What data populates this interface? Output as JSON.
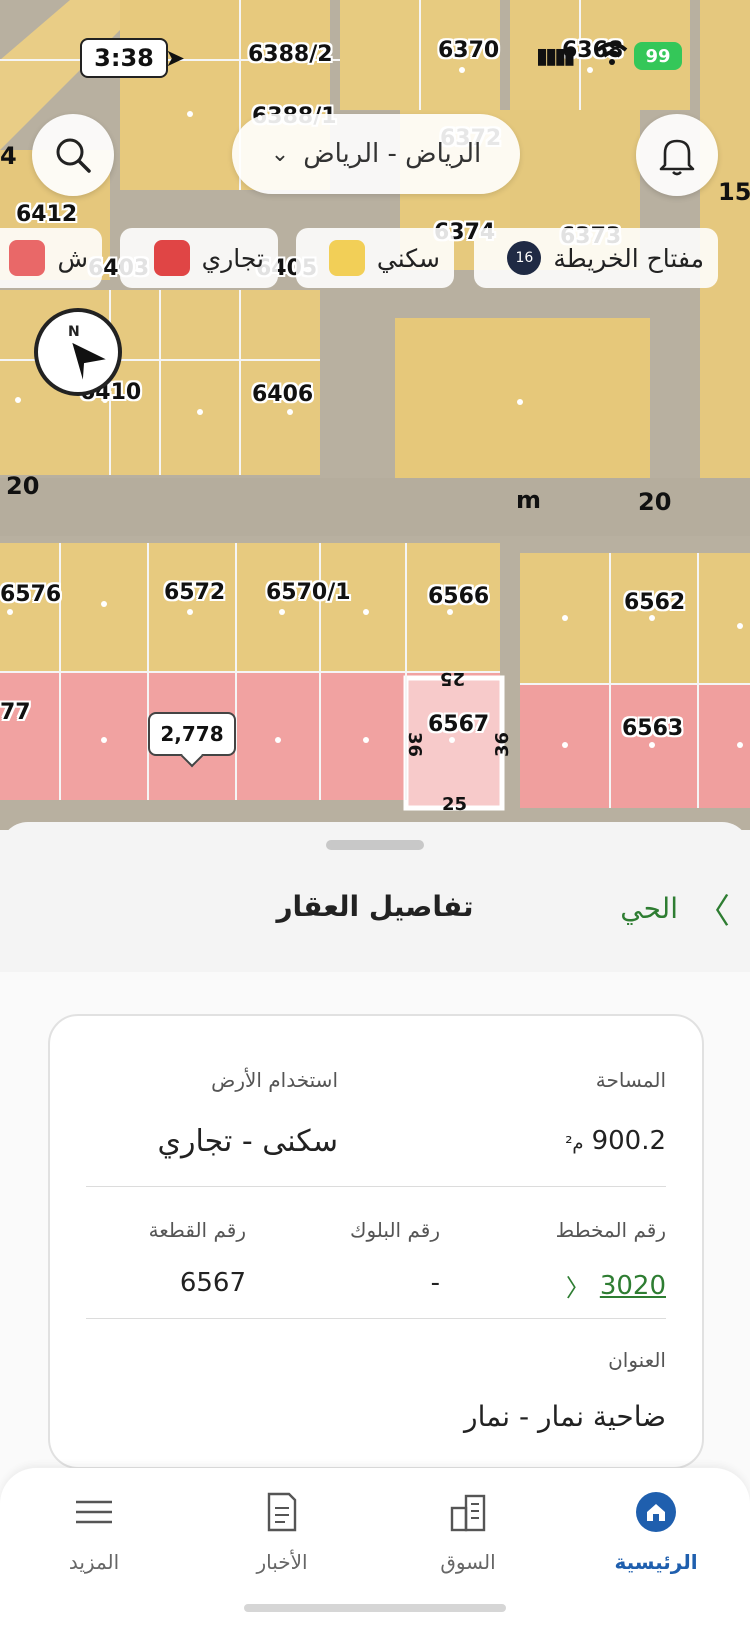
{
  "status_bar": {
    "time": "3:38",
    "battery": "99"
  },
  "header": {
    "city": "الرياض - الرياض",
    "search_icon": "search-icon",
    "bell_icon": "bell-icon"
  },
  "legend": {
    "title": "مفتاح الخريطة",
    "zoom": "16",
    "items": [
      {
        "label": "سكني",
        "color": "#f2cf57"
      },
      {
        "label": "تجاري",
        "color": "#e04545"
      },
      {
        "label": "ش",
        "color": "#e96868"
      }
    ]
  },
  "map": {
    "plots": [
      "6388/2",
      "6370",
      "6368",
      "6388/1",
      "6372",
      "6412",
      "6374",
      "6373",
      "6403",
      "6405",
      "6410",
      "6406",
      "6576",
      "6572",
      "6570/1",
      "6566",
      "6562",
      "6567",
      "6563",
      "77"
    ],
    "street_widths": [
      "20",
      "20",
      "15",
      "4"
    ],
    "dimensions": {
      "top": "25",
      "bottom": "25",
      "left": "36",
      "right": "36"
    },
    "marker": "m",
    "price": "2,778",
    "compass": "N",
    "colors": {
      "residential": "#e8c97a",
      "commercial": "#f2a0a0",
      "selected": "#f7c5c5",
      "road": "#b8b0a0"
    }
  },
  "sheet": {
    "title": "تفاصيل العقار",
    "back_label": "الحي"
  },
  "details": {
    "area_label": "المساحة",
    "area_value": "900.2",
    "area_unit": "م²",
    "land_use_label": "استخدام الأرض",
    "land_use_value": "سكنى - تجاري",
    "plan_label": "رقم المخطط",
    "plan_value": "3020",
    "block_label": "رقم البلوك",
    "block_value": "-",
    "plot_label": "رقم القطعة",
    "plot_value": "6567",
    "address_label": "العنوان",
    "address_value": "ضاحية نمار - نمار"
  },
  "nav": {
    "home": "الرئيسية",
    "market": "السوق",
    "news": "الأخبار",
    "more": "المزيد"
  },
  "accent_color": "#2e7d32",
  "nav_active_color": "#1f5fae"
}
